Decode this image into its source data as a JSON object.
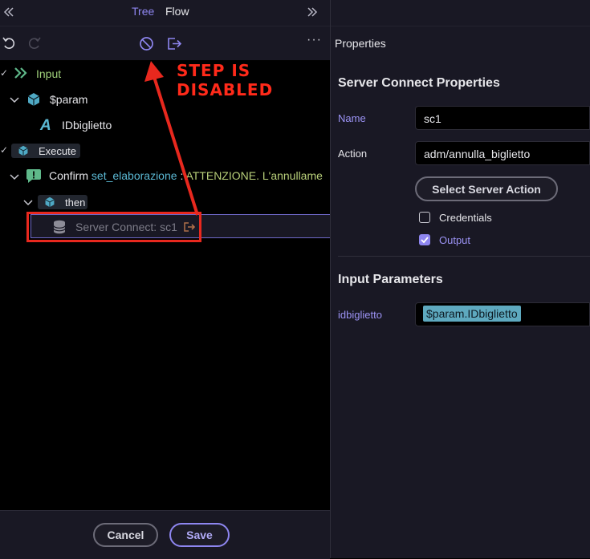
{
  "left_panel": {
    "tabs": [
      {
        "label": "Tree",
        "active": true
      },
      {
        "label": "Flow",
        "active": false
      }
    ],
    "tree": {
      "input_label": "Input",
      "param_label": "$param",
      "param_child_label": "IDbiglietto",
      "execute_label": "Execute",
      "confirm_label": "Confirm",
      "confirm_var": "set_elaborazione",
      "confirm_sep": ":",
      "confirm_text": "ATTENZIONE. L'annullame",
      "then_label": "then",
      "sc_label": "Server Connect:",
      "sc_name": "sc1"
    },
    "annotation": "STEP IS DISABLED",
    "footer": {
      "cancel_label": "Cancel",
      "save_label": "Save"
    }
  },
  "right_panel": {
    "title": "Properties",
    "section_title": "Server Connect Properties",
    "name_label": "Name",
    "name_value": "sc1",
    "action_label": "Action",
    "action_value": "adm/annulla_biglietto",
    "select_action_label": "Select Server Action",
    "credentials_label": "Credentials",
    "credentials_checked": false,
    "output_label": "Output",
    "output_checked": true,
    "input_params_title": "Input Parameters",
    "param_label": "idbiglietto",
    "param_value": "$param.IDbiglietto"
  },
  "colors": {
    "accent": "#8e86f0",
    "annotation": "#ff2a1a",
    "panel_bg": "#191824",
    "tree_bg": "#000000"
  }
}
